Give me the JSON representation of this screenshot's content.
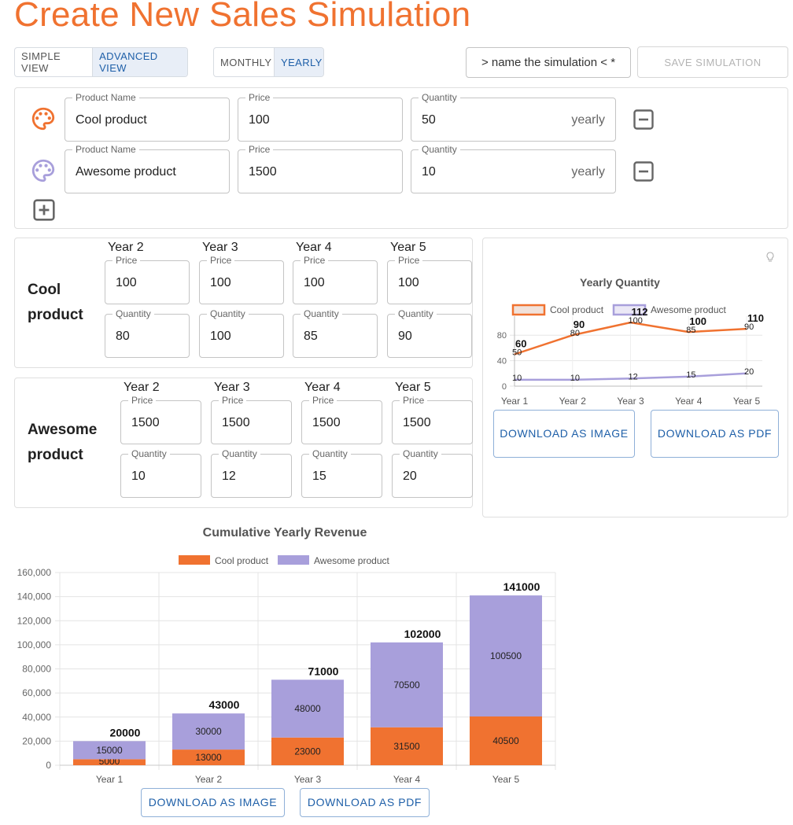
{
  "page": {
    "title": "Create New Sales Simulation"
  },
  "toolbar": {
    "view_modes": [
      {
        "label": "SIMPLE VIEW",
        "active": false
      },
      {
        "label": "ADVANCED VIEW",
        "active": true
      }
    ],
    "periods": [
      {
        "label": "MONTHLY",
        "active": false
      },
      {
        "label": "YEARLY",
        "active": true
      }
    ],
    "name_placeholder": "> name the simulation < *",
    "save_label": "SAVE SIMULATION"
  },
  "products_panel": {
    "products": [
      {
        "name_label": "Product Name",
        "name": "Cool product",
        "price_label": "Price",
        "price": "100",
        "quantity_label": "Quantity",
        "quantity": "50",
        "quantity_suffix": "yearly",
        "color": "#f07230",
        "icon": "palette-icon"
      },
      {
        "name_label": "Product Name",
        "name": "Awesome product",
        "price_label": "Price",
        "price": "1500",
        "quantity_label": "Quantity",
        "quantity": "10",
        "quantity_suffix": "yearly",
        "color": "#a89fdb",
        "icon": "palette-icon"
      }
    ]
  },
  "yearly_inputs": [
    {
      "product": "Cool product",
      "years": [
        {
          "year": "Year 2",
          "price_label": "Price",
          "price": "100",
          "quantity_label": "Quantity",
          "quantity": "80"
        },
        {
          "year": "Year 3",
          "price_label": "Price",
          "price": "100",
          "quantity_label": "Quantity",
          "quantity": "100"
        },
        {
          "year": "Year 4",
          "price_label": "Price",
          "price": "100",
          "quantity_label": "Quantity",
          "quantity": "85"
        },
        {
          "year": "Year 5",
          "price_label": "Price",
          "price": "100",
          "quantity_label": "Quantity",
          "quantity": "90"
        }
      ]
    },
    {
      "product": "Awesome product",
      "years": [
        {
          "year": "Year 2",
          "price_label": "Price",
          "price": "1500",
          "quantity_label": "Quantity",
          "quantity": "10"
        },
        {
          "year": "Year 3",
          "price_label": "Price",
          "price": "1500",
          "quantity_label": "Quantity",
          "quantity": "12"
        },
        {
          "year": "Year 4",
          "price_label": "Price",
          "price": "1500",
          "quantity_label": "Quantity",
          "quantity": "15"
        },
        {
          "year": "Year 5",
          "price_label": "Price",
          "price": "1500",
          "quantity_label": "Quantity",
          "quantity": "20"
        }
      ]
    }
  ],
  "quantity_chart_buttons": {
    "image": "DOWNLOAD AS IMAGE",
    "pdf": "DOWNLOAD AS PDF"
  },
  "revenue_chart_buttons": {
    "image": "DOWNLOAD AS IMAGE",
    "pdf": "DOWNLOAD AS PDF"
  },
  "colors": {
    "accent": "#f07230",
    "cool": "#f07230",
    "awesome": "#a89fdb",
    "primary": "#1e5fa8"
  },
  "chart_data": [
    {
      "type": "line",
      "title": "Yearly Quantity",
      "categories": [
        "Year 1",
        "Year 2",
        "Year 3",
        "Year 4",
        "Year 5"
      ],
      "series": [
        {
          "name": "Cool product",
          "values": [
            50,
            80,
            100,
            85,
            90
          ],
          "color": "#f07230"
        },
        {
          "name": "Awesome product",
          "values": [
            10,
            10,
            12,
            15,
            20
          ],
          "color": "#a89fdb"
        }
      ],
      "totals": [
        60,
        90,
        112,
        100,
        110
      ],
      "ylim": [
        0,
        100
      ],
      "yticks": [
        0,
        40,
        80
      ],
      "legend": "top",
      "grid": true
    },
    {
      "type": "bar",
      "stacked": true,
      "title": "Cumulative Yearly Revenue",
      "categories": [
        "Year 1",
        "Year 2",
        "Year 3",
        "Year 4",
        "Year 5"
      ],
      "series": [
        {
          "name": "Cool product",
          "values": [
            5000,
            13000,
            23000,
            31500,
            40500
          ],
          "color": "#f07230"
        },
        {
          "name": "Awesome product",
          "values": [
            15000,
            30000,
            48000,
            70500,
            100500
          ],
          "color": "#a89fdb"
        }
      ],
      "totals": [
        20000,
        43000,
        71000,
        102000,
        141000
      ],
      "ylim": [
        0,
        160000
      ],
      "yticks": [
        "0",
        "20,000",
        "40,000",
        "60,000",
        "80,000",
        "100,000",
        "120,000",
        "140,000",
        "160,000"
      ],
      "legend": "top",
      "grid": true
    }
  ]
}
